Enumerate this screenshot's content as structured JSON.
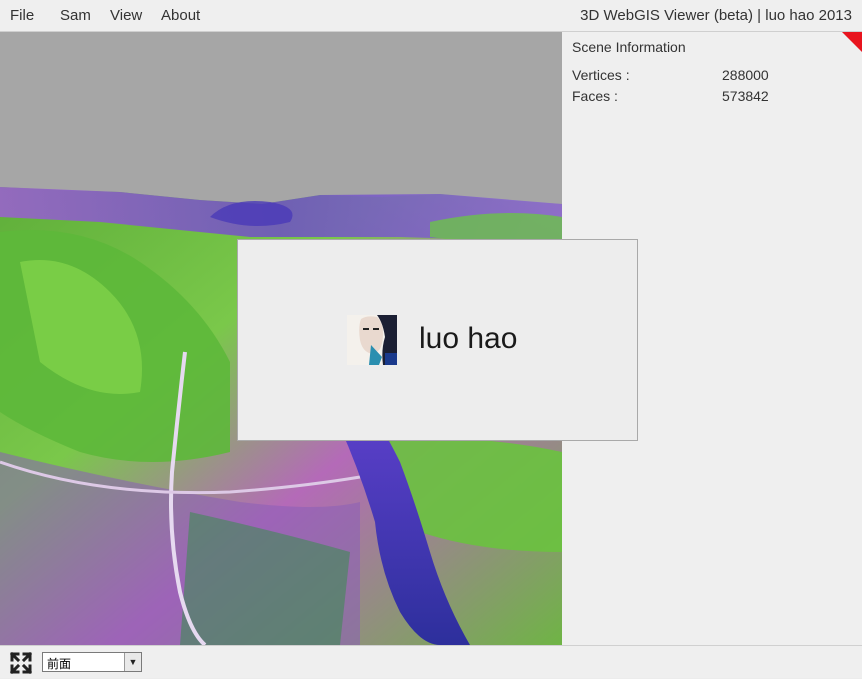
{
  "menu": {
    "file": "File",
    "sam": "Sam",
    "view": "View",
    "about": "About"
  },
  "app_title": "3D WebGIS Viewer (beta) | luo hao 2013",
  "scene_info": {
    "title": "Scene Information",
    "vertices_label": "Vertices :",
    "vertices_value": "288000",
    "faces_label": "Faces :",
    "faces_value": "573842"
  },
  "about_popup": {
    "name": "luo hao"
  },
  "statusbar": {
    "view_select_value": "前面",
    "fullscreen_icon": "fullscreen-icon",
    "dropdown_icon": "chevron-down-icon"
  },
  "colors": {
    "corner_badge": "#e8141e",
    "sky": "#a6a6a6",
    "panel_bg": "#efefef"
  }
}
